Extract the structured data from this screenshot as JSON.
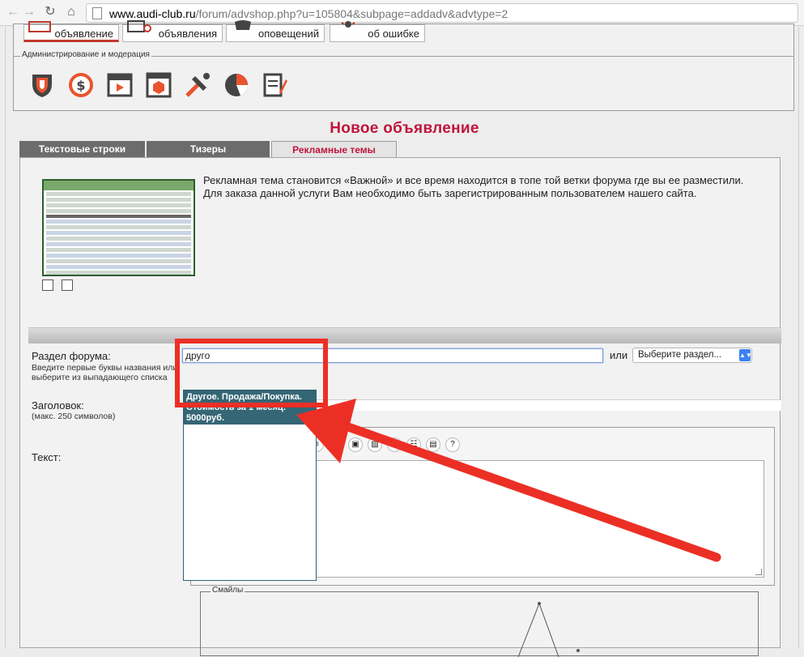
{
  "browser": {
    "url_domain": "www.audi-club.ru",
    "url_path": "/forum/advshop.php?u=105804&subpage=addadv&advtype=2"
  },
  "top_tabs": [
    {
      "label": "объявление",
      "active": true
    },
    {
      "label": "объявления",
      "active": false
    },
    {
      "label": "оповещений",
      "active": false
    },
    {
      "label": "об ошибке",
      "active": false
    }
  ],
  "admin": {
    "legend": "Администрирование и модерация",
    "icons": [
      "shield-icon",
      "dollar-icon",
      "video-icon",
      "box-icon",
      "tools-icon",
      "pie-chart-icon",
      "notepad-icon"
    ]
  },
  "page_title": "Новое объявление",
  "section_tabs": [
    {
      "label": "Текстовые строки",
      "selected": false
    },
    {
      "label": "Тизеры",
      "selected": false
    },
    {
      "label": "Рекламные темы",
      "selected": true
    }
  ],
  "description": {
    "line1": "Рекламная тема становится «Важной» и все время находится в топе той ветки форума где вы ее разместили.",
    "line2": "Для заказа данной услуги Вам необходимо быть зарегистрированным пользователем нашего сайта."
  },
  "form": {
    "section_label": "Раздел форума:",
    "section_hint": "Введите первые буквы названия или выберите из выпадающего списка",
    "section_value": "друго",
    "or_label": "или",
    "select_value": "Выберите раздел...",
    "title_label": "Заголовок:",
    "title_hint": "(макс. 250 символов)",
    "text_label": "Текст:",
    "smiles_legend": "Смайлы"
  },
  "autocomplete": {
    "suggestion": "Другое. Продажа/Покупка. Стоимость за 1 месяц: 5000руб."
  },
  "colors": {
    "title": "#c0143c",
    "annotation": "#ec2f25",
    "suggestion_bg": "#356675"
  }
}
